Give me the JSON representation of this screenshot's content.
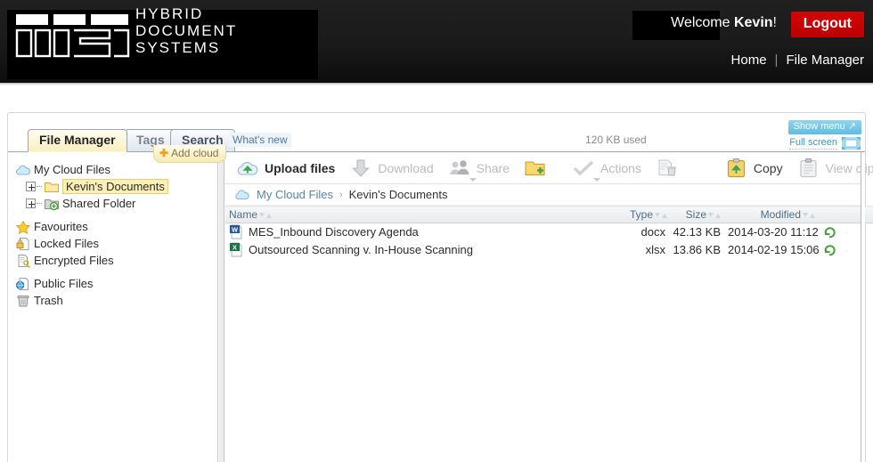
{
  "header": {
    "logo_line1": "HYBRID",
    "logo_line2": "DOCUMENT",
    "logo_line3": "SYSTEMS",
    "logo_mark_alt": "MES",
    "welcome_prefix": "Welcome ",
    "welcome_user": "Kevin",
    "welcome_suffix": "!",
    "logout_label": "Logout",
    "nav_home": "Home",
    "nav_sep": "|",
    "nav_file_manager": "File Manager",
    "logout_color": "#c90000"
  },
  "panel": {
    "show_menu_label": "Show menu",
    "show_menu_glyph": "↗",
    "full_screen_label": "Full screen",
    "kb_used": "120 KB used",
    "whats_new": "What's new",
    "accent_blue": "#73c7e8",
    "tabs": [
      {
        "label": "File Manager",
        "active": true
      },
      {
        "label": "Tags",
        "active": false
      },
      {
        "label": "Search",
        "active": false
      }
    ]
  },
  "sidebar": {
    "add_cloud_label": "Add cloud",
    "items": [
      {
        "label": "My Cloud Files",
        "icon": "cloud-icon",
        "indent": false,
        "expander": false,
        "selected": false
      },
      {
        "label": "Kevin's Documents",
        "icon": "folder-icon",
        "indent": true,
        "expander": true,
        "selected": true
      },
      {
        "label": "Shared Folder",
        "icon": "shared-folder-icon",
        "indent": true,
        "expander": true,
        "selected": false
      },
      {
        "label": "Favourites",
        "icon": "star-icon",
        "indent": false,
        "expander": false,
        "selected": false,
        "gap_before": true
      },
      {
        "label": "Locked Files",
        "icon": "lock-file-icon",
        "indent": false,
        "expander": false,
        "selected": false
      },
      {
        "label": "Encrypted Files",
        "icon": "key-file-icon",
        "indent": false,
        "expander": false,
        "selected": false
      },
      {
        "label": "Public Files",
        "icon": "globe-file-icon",
        "indent": false,
        "expander": false,
        "selected": false,
        "gap_before": true
      },
      {
        "label": "Trash",
        "icon": "trash-icon",
        "indent": false,
        "expander": false,
        "selected": false
      }
    ]
  },
  "toolbar": {
    "items": [
      {
        "label": "Upload files",
        "icon": "upload-cloud-icon",
        "state": "enabled",
        "caret": false
      },
      {
        "label": "Download",
        "icon": "download-arrow-icon",
        "state": "disabled",
        "caret": false
      },
      {
        "label": "Share",
        "icon": "share-users-icon",
        "state": "disabled",
        "caret": true
      },
      {
        "label": "",
        "icon": "new-folder-icon",
        "state": "enabled",
        "caret": false
      },
      {
        "label": "Actions",
        "icon": "check-actions-icon",
        "state": "disabled",
        "caret": true
      },
      {
        "label": "",
        "icon": "delete-file-icon",
        "state": "disabled",
        "caret": false
      },
      {
        "label": "Copy",
        "icon": "copy-clipboard-icon",
        "state": "plain",
        "caret": false
      },
      {
        "label": "View clipboard",
        "icon": "view-clipboard-icon",
        "state": "disabled",
        "caret": false
      }
    ]
  },
  "breadcrumb": {
    "root": "My Cloud Files",
    "separator": "›",
    "current": "Kevin's Documents"
  },
  "filetable": {
    "columns": [
      "Name",
      "Type",
      "Size",
      "Modified"
    ],
    "rows": [
      {
        "name": "MES_Inbound Discovery Agenda",
        "icon": "word-doc-icon",
        "type": "docx",
        "size": "42.13 KB",
        "modified": "2014-03-20 11:12",
        "flag": "sync-icon",
        "dots": "· · ·"
      },
      {
        "name": "Outsourced Scanning v. In-House Scanning",
        "icon": "excel-doc-icon",
        "type": "xlsx",
        "size": "13.86 KB",
        "modified": "2014-02-19 15:06",
        "flag": "sync-icon",
        "dots": "· · ·"
      }
    ]
  }
}
